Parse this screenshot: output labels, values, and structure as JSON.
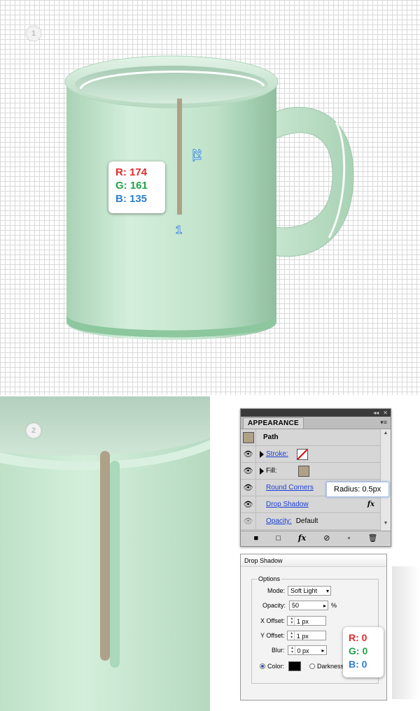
{
  "step1": {
    "badge": "1",
    "rgb": {
      "r": "R: 174",
      "g": "G: 161",
      "b": "B: 135"
    },
    "dim_height": "21",
    "dim_width": "1"
  },
  "step2": {
    "badge": "2"
  },
  "appearance_panel": {
    "tab_label": "APPEARANCE",
    "collapse_glyph": "◂◂",
    "close_glyph": "✕",
    "menu_glyph": "▾≡",
    "header": "Path",
    "rows": [
      {
        "label": "Stroke:",
        "link": true
      },
      {
        "label": "Fill:",
        "link": false
      },
      {
        "label": "Round Corners",
        "link": true
      },
      {
        "label": "Drop Shadow",
        "link": true,
        "icon": "fx"
      },
      {
        "label": "Opacity:",
        "link": true,
        "value": "Default"
      }
    ],
    "tooltip": "Radius: 0.5px",
    "fill_color": "#ae a187",
    "bottom_icons": [
      "■",
      "□",
      "fx",
      "⊘",
      "▫",
      "🗑"
    ]
  },
  "drop_shadow_dialog": {
    "title": "Drop Shadow",
    "group_label": "Options",
    "mode_label": "Mode:",
    "mode_value": "Soft Light",
    "opacity_label": "Opacity:",
    "opacity_value": "50",
    "opacity_unit": "%",
    "x_offset_label": "X Offset:",
    "x_offset_value": "1 px",
    "y_offset_label": "Y Offset:",
    "y_offset_value": "1 px",
    "blur_label": "Blur:",
    "blur_value": "0 px",
    "color_label": "Color:",
    "darkness_label": "Darkness:",
    "rgb": {
      "r": "R: 0",
      "g": "G: 0",
      "b": "B: 0"
    }
  },
  "colors": {
    "mug_light": "#d2ecd9",
    "mug_dark": "#a6ccb2",
    "stick": "#aea187",
    "accent_link": "#1a3ed6"
  }
}
